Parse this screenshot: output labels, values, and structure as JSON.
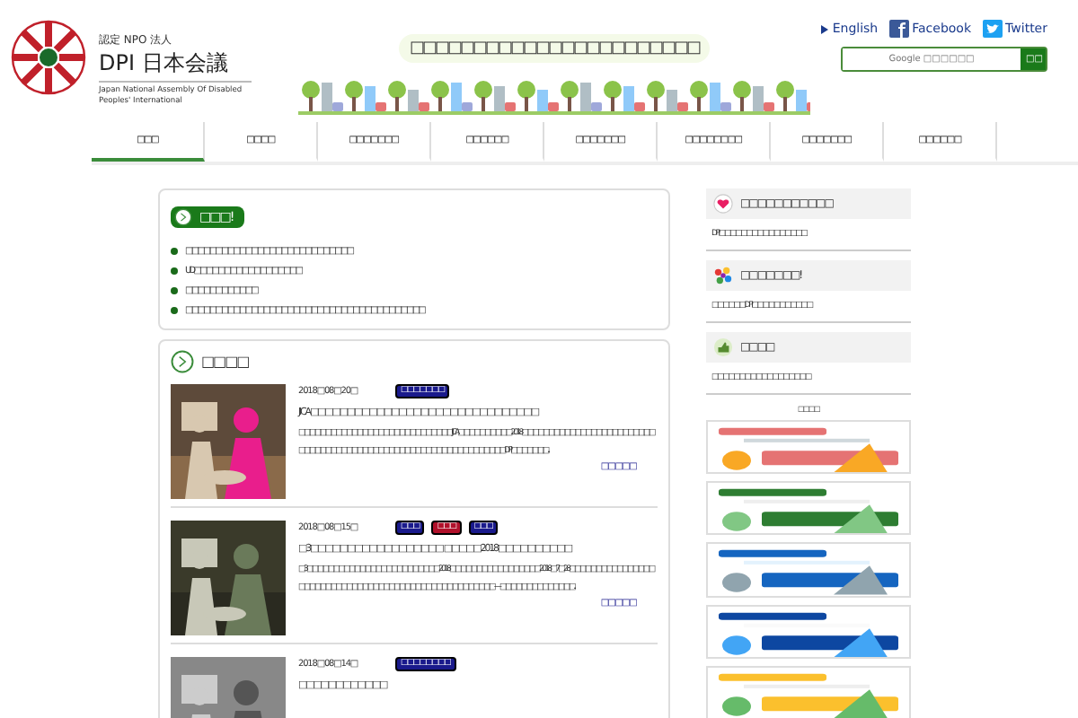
{
  "header": {
    "certification": "認定 NPO 法人",
    "org_name": "DPI 日本会議",
    "org_name_en": "Japan National Assembly Of Disabled Peoples' International",
    "tagline": "□□□□□□□□□□□□□□□□□□□□□□□",
    "links": [
      {
        "kind": "arrow",
        "label": "English"
      },
      {
        "kind": "facebook",
        "label": "Facebook"
      },
      {
        "kind": "twitter",
        "label": "Twitter"
      }
    ],
    "search": {
      "placeholder": "Google □□□□□□",
      "button": "□□"
    }
  },
  "nav": [
    {
      "label": "□□□",
      "selected": true
    },
    {
      "label": "□□□□",
      "selected": false
    },
    {
      "label": "□□□□□□□",
      "selected": false
    },
    {
      "label": "□□□□□□",
      "selected": false
    },
    {
      "label": "□□□□□□□",
      "selected": false
    },
    {
      "label": "□□□□□□□□",
      "selected": false
    },
    {
      "label": "□□□□□□□",
      "selected": false
    },
    {
      "label": "□□□□□□",
      "selected": false
    }
  ],
  "notice": {
    "title": "□□□!",
    "items": [
      "□□□□□□□□□□□□□□□□□□□□□□□□□□□□",
      "UD□□□□□□□□□□□□□□□□□□",
      "□□□□□□□□□□□□",
      "□□□□□□□□□□□□□□□□□□□□□□□□□□□□□□□□□□□□□□□□"
    ]
  },
  "news": {
    "title": "□□□□",
    "items": [
      {
        "date": "2018□08□20□",
        "tags": [
          {
            "label": "□□□□□□□",
            "color": "#1a1a8c"
          }
        ],
        "title": "JICA□□□□□□□□□□□□□□□□□□□□□□□□□□□□□□□",
        "excerpt": "□□□□□□□□□□□□□□□□□□□□□□□□□□□□□ JICA□□□□□□□□□□2018□□□□□□□□□□□□□□□□□□□□□□□□□□□□□□□□□□□□□□□□□□□□□□□□□□□□□□□□□□□□□□□□DPI□□□□□□□...",
        "more": "□□□□□"
      },
      {
        "date": "2018□08□15□",
        "tags": [
          {
            "label": "□□□",
            "color": "#1a1a8c"
          },
          {
            "label": "□□□",
            "color": "#b0102a"
          },
          {
            "label": "□□□",
            "color": "#1a1a8c"
          }
        ],
        "title": "□3□□□□□□□□□□□□□□□□□□ □□□□□2018□□□□□□□□□□",
        "excerpt": "□3□□□□□□□□□□□□□□□□□□□□□□□□□2018□□□□□□□□□□□□□□□□□2018□7□28□□□□□□□□□□□□□□□□□□□□□□□□□ □□□□□□□□□□□□□□□□□□□□□□□□□□□□—□□□□□□□□□□□□ □□...",
        "more": "□□□□□"
      },
      {
        "date": "2018□08□14□",
        "tags": [
          {
            "label": "□□□□□□□□",
            "color": "#1a1a8c"
          }
        ],
        "title": "□□□□□□□□□□□□"
      }
    ]
  },
  "sidebar": {
    "sections": [
      {
        "kind": "heart",
        "title": "□□□□□□□□□□□",
        "link": "DPI□□□□□□□□□□□□□□□□"
      },
      {
        "kind": "burst",
        "title": "□□□□□□□!",
        "link": "□□□□□□DPI□□□□□□□□□□□"
      },
      {
        "kind": "hand",
        "title": "□□□□",
        "link": "□□□□□□□□□□□□□□□□□□"
      }
    ],
    "banner_caption": "□□□□"
  }
}
